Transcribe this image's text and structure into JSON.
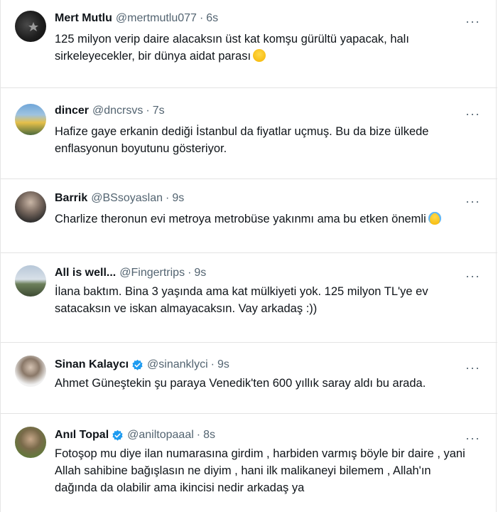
{
  "tweets": [
    {
      "name": "Mert Mutlu",
      "handle": "@mertmutlu077",
      "time": "6s",
      "verified": false,
      "text": "125 milyon verip daire alacaksın üst kat komşu gürültü yapacak, halı sirkeleyecekler, bir dünya aidat parası",
      "emoji": "grinning-face"
    },
    {
      "name": "dincer",
      "handle": "@dncrsvs",
      "time": "7s",
      "verified": false,
      "text": "Hafize gaye erkanin dediği İstanbul da fiyatlar uçmuş. Bu da bize ülkede enflasyonun boyutunu gösteriyor."
    },
    {
      "name": "Barrik",
      "handle": "@BSsoyaslan",
      "time": "9s",
      "verified": false,
      "text": "Charlize theronun evi metroya metrobüse yakınmı ama bu etken önemli",
      "emoji": "crying-laughing-face"
    },
    {
      "name": "All is well...",
      "handle": "@Fingertrips",
      "time": "9s",
      "verified": false,
      "text": "İlana baktım. Bina 3 yaşında ama kat mülkiyeti yok. 125 milyon TL'ye ev satacaksın ve iskan almayacaksın. Vay arkadaş :))"
    },
    {
      "name": "Sinan Kalaycı",
      "handle": "@sinanklyci",
      "time": "9s",
      "verified": true,
      "text": "Ahmet Güneştekin şu paraya Venedik'ten 600 yıllık saray aldı bu arada."
    },
    {
      "name": "Anıl Topal",
      "handle": "@aniltopaaal",
      "time": "8s",
      "verified": true,
      "text": "Fotoşop mu diye ilan numarasına girdim , harbiden varmış böyle bir daire , yani Allah sahibine bağışlasın ne diyim , hani ilk malikaneyi bilemem , Allah'ın dağında da olabilir ama ikincisi nedir arkadaş ya"
    }
  ],
  "more_label": "···",
  "colors": {
    "verified": "#1d9bf0",
    "secondary_text": "#536471",
    "divider": "#e3e3e3"
  }
}
